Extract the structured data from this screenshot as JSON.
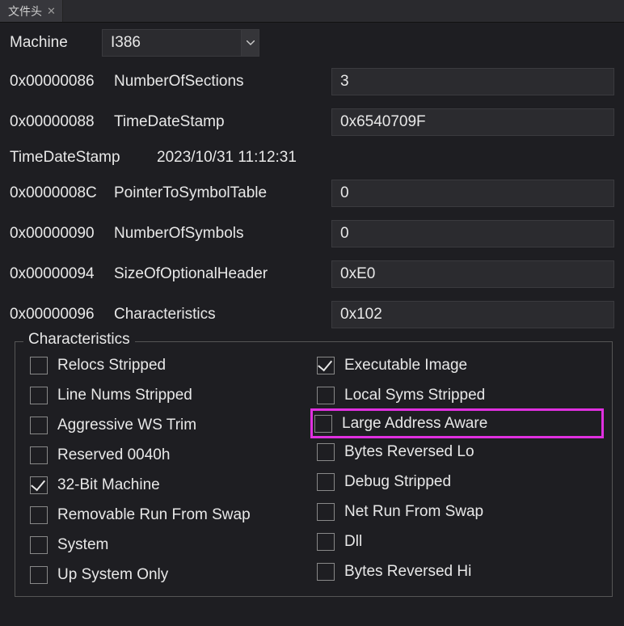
{
  "tab": {
    "title": "文件头"
  },
  "machine": {
    "label": "Machine",
    "value": "I386"
  },
  "rows": [
    {
      "addr": "0x00000086",
      "label": "NumberOfSections",
      "value": "3"
    },
    {
      "addr": "0x00000088",
      "label": "TimeDateStamp",
      "value": "0x6540709F"
    }
  ],
  "tds": {
    "label": "TimeDateStamp",
    "value": "2023/10/31 11:12:31"
  },
  "rows2": [
    {
      "addr": "0x0000008C",
      "label": "PointerToSymbolTable",
      "value": "0"
    },
    {
      "addr": "0x00000090",
      "label": "NumberOfSymbols",
      "value": "0"
    },
    {
      "addr": "0x00000094",
      "label": "SizeOfOptionalHeader",
      "value": "0xE0"
    },
    {
      "addr": "0x00000096",
      "label": "Characteristics",
      "value": "0x102"
    }
  ],
  "characteristics": {
    "legend": "Characteristics",
    "left": [
      {
        "label": "Relocs Stripped",
        "checked": false
      },
      {
        "label": "Line Nums Stripped",
        "checked": false
      },
      {
        "label": "Aggressive WS Trim",
        "checked": false
      },
      {
        "label": "Reserved 0040h",
        "checked": false
      },
      {
        "label": "32-Bit Machine",
        "checked": true
      },
      {
        "label": "Removable Run From Swap",
        "checked": false
      },
      {
        "label": "System",
        "checked": false
      },
      {
        "label": "Up System Only",
        "checked": false
      }
    ],
    "right": [
      {
        "label": "Executable Image",
        "checked": true
      },
      {
        "label": "Local Syms Stripped",
        "checked": false
      },
      {
        "label": "Large Address Aware",
        "checked": false,
        "highlight": true
      },
      {
        "label": "Bytes Reversed Lo",
        "checked": false
      },
      {
        "label": "Debug Stripped",
        "checked": false
      },
      {
        "label": "Net Run From Swap",
        "checked": false
      },
      {
        "label": "Dll",
        "checked": false
      },
      {
        "label": "Bytes Reversed Hi",
        "checked": false
      }
    ]
  }
}
